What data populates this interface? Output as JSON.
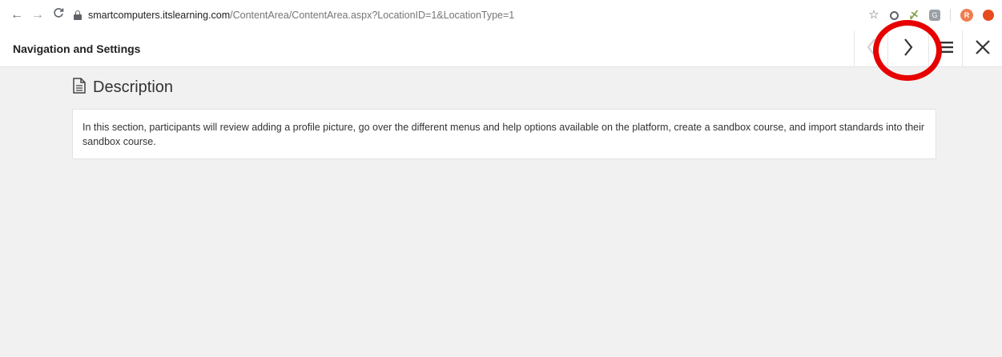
{
  "browser": {
    "url_host": "smartcomputers.itslearning.com",
    "url_path": "/ContentArea/ContentArea.aspx?LocationID=1&LocationType=1",
    "back_icon": "arrow-left-icon",
    "forward_icon": "arrow-right-icon",
    "reload_icon": "reload-icon",
    "profile_initial": "R"
  },
  "header": {
    "title": "Navigation and Settings",
    "prev_icon": "chevron-left-icon",
    "next_icon": "chevron-right-icon",
    "menu_icon": "hamburger-icon",
    "close_icon": "close-icon",
    "highlight_color": "#e60000"
  },
  "content": {
    "section_title": "Description",
    "description": "In this section, participants will review adding a profile picture, go over the different menus and help options available on the platform, create a sandbox course, and import standards into their sandbox course."
  }
}
